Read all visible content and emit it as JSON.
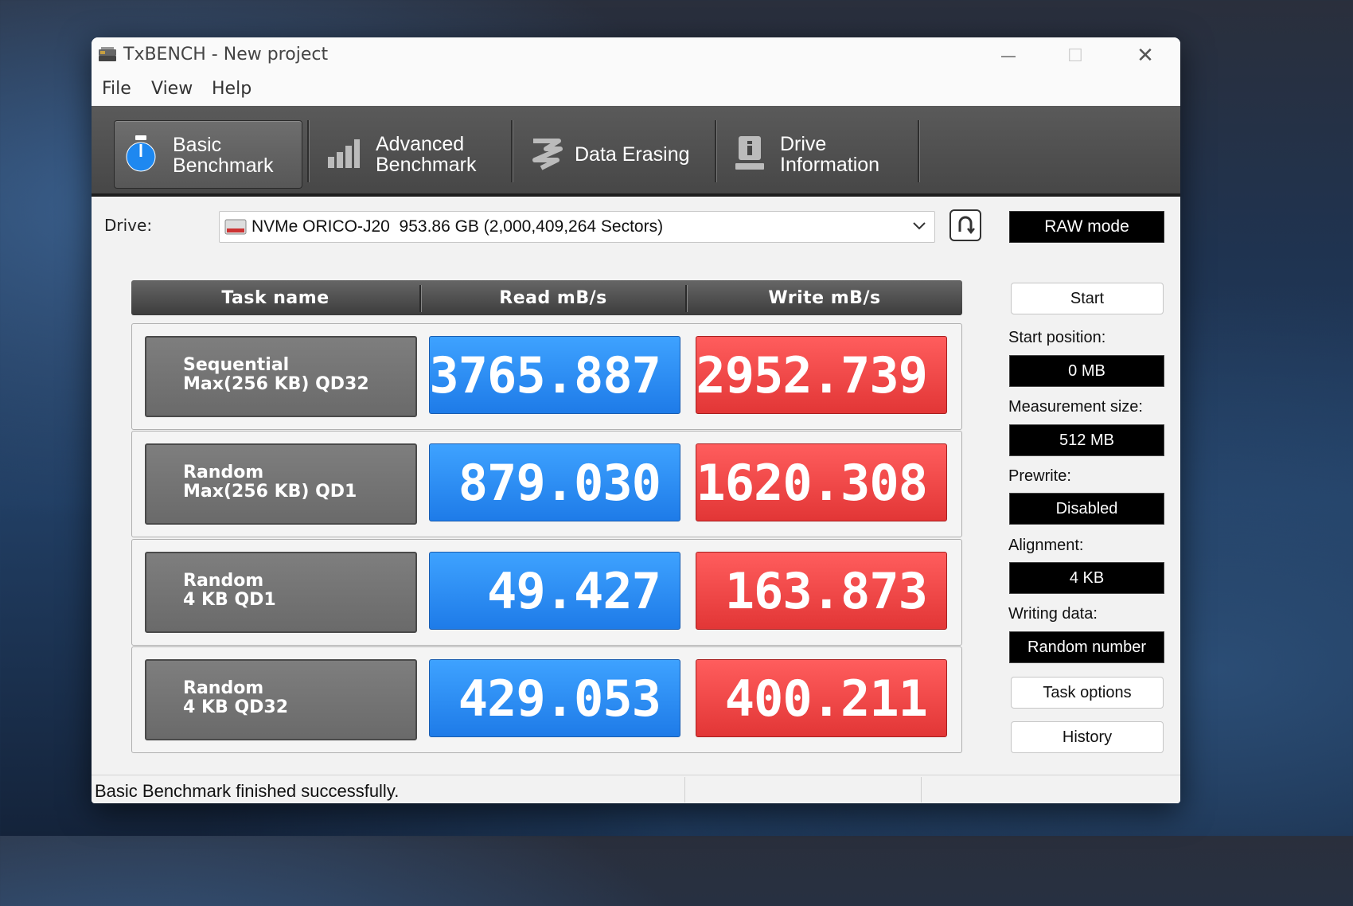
{
  "window": {
    "title": "TxBENCH - New project",
    "controls": {
      "minimize": "—",
      "maximize": "☐",
      "close": "✕"
    }
  },
  "menu": [
    "File",
    "View",
    "Help"
  ],
  "tabs": [
    {
      "line1": "Basic",
      "line2": "Benchmark",
      "icon": "stopwatch-icon",
      "active": true
    },
    {
      "line1": "Advanced",
      "line2": "Benchmark",
      "icon": "bar-chart-icon",
      "active": false
    },
    {
      "line1": "Data Erasing",
      "line2": "",
      "icon": "eraser-icon",
      "active": false
    },
    {
      "line1": "Drive",
      "line2": "Information",
      "icon": "drive-info-icon",
      "active": false
    }
  ],
  "drive": {
    "label": "Drive:",
    "selected": "NVMe ORICO-J20  953.86 GB (2,000,409,264 Sectors)",
    "raw_mode": "RAW mode"
  },
  "table": {
    "headers": [
      "Task name",
      "Read mB/s",
      "Write mB/s"
    ],
    "rows": [
      {
        "line1": "Sequential",
        "line2": "Max(256 KB) QD32",
        "read": "3765.887",
        "write": "2952.739"
      },
      {
        "line1": "Random",
        "line2": "Max(256 KB) QD1",
        "read": "879.030",
        "write": "1620.308"
      },
      {
        "line1": "Random",
        "line2": "4 KB QD1",
        "read": "49.427",
        "write": "163.873"
      },
      {
        "line1": "Random",
        "line2": "4 KB QD32",
        "read": "429.053",
        "write": "400.211"
      }
    ]
  },
  "sidebar": {
    "start": "Start",
    "start_position_label": "Start position:",
    "start_position": "0 MB",
    "measurement_size_label": "Measurement size:",
    "measurement_size": "512 MB",
    "prewrite_label": "Prewrite:",
    "prewrite": "Disabled",
    "alignment_label": "Alignment:",
    "alignment": "4 KB",
    "writing_data_label": "Writing data:",
    "writing_data": "Random number",
    "task_options": "Task options",
    "history": "History"
  },
  "colors": {
    "read": "#1e7be8",
    "write": "#e23636",
    "toolbar": "#4a4a4a"
  },
  "status": "Basic Benchmark finished successfully."
}
